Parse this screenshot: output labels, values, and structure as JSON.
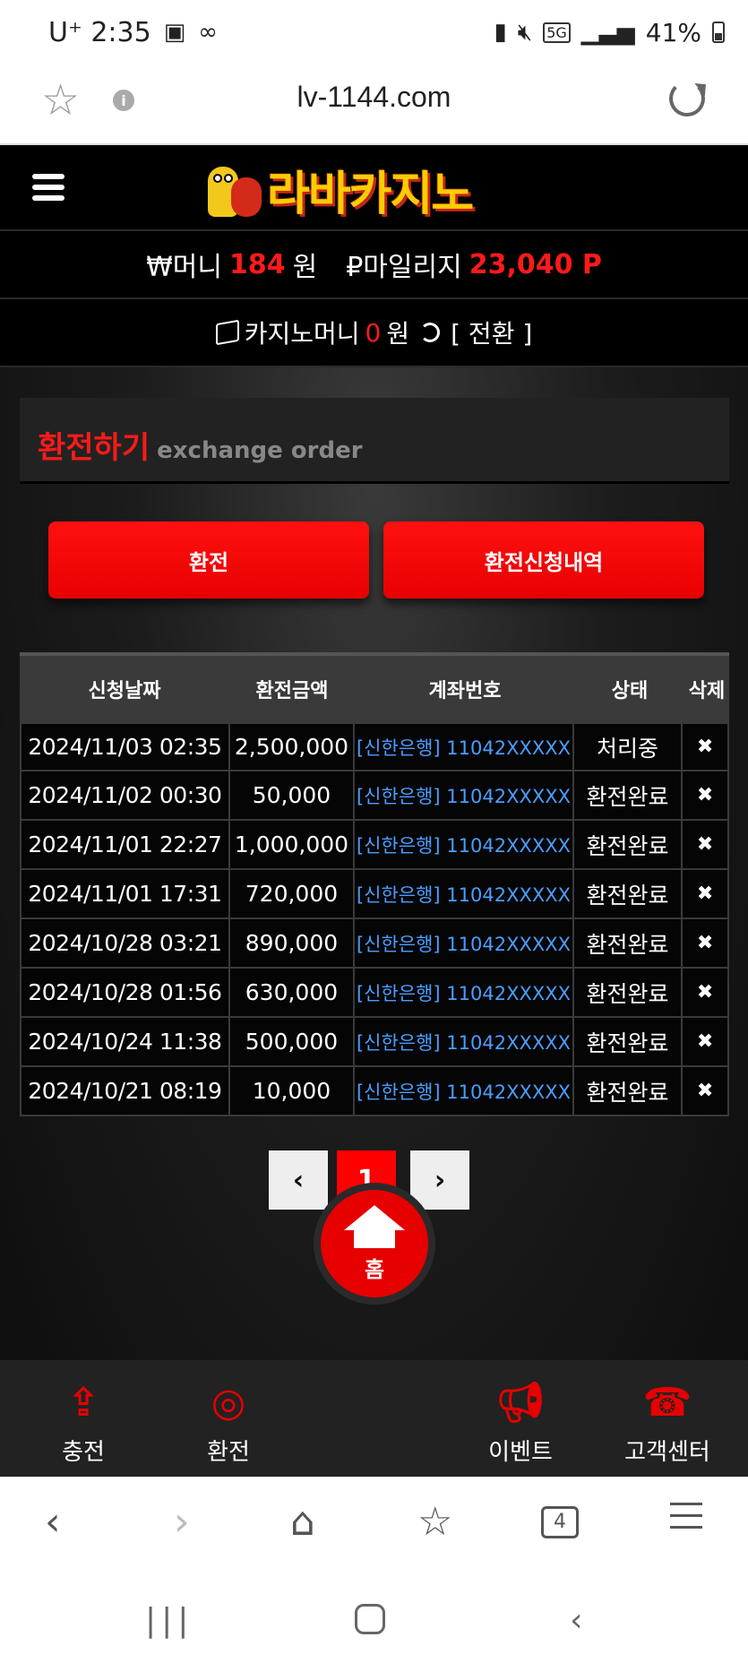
{
  "statusbar": {
    "carrier_time": "U⁺ 2:35",
    "battery": "41%",
    "network": "5G"
  },
  "browser": {
    "url": "lv-1144.com",
    "tab_count": "4"
  },
  "site": {
    "brand": "라바카지노",
    "wallet": {
      "money_label": "₩머니",
      "money_value": "184",
      "money_unit": "원",
      "mileage_label": "₽마일리지",
      "mileage_value": "23,040 P"
    },
    "casino": {
      "label": "카지노머니",
      "value": "0",
      "unit": "원",
      "convert_label": "[ 전환 ]"
    },
    "panel": {
      "title_ko": "환전하기",
      "title_en": "exchange order"
    },
    "buttons": {
      "exchange": "환전",
      "history": "환전신청내역"
    },
    "table": {
      "headers": [
        "신청날짜",
        "환전금액",
        "계좌번호",
        "상태",
        "삭제"
      ],
      "rows": [
        {
          "date": "2024/11/03 02:35",
          "amount": "2,500,000",
          "account": "[신한은행] 11042XXXXX",
          "status": "처리중",
          "del": "✖"
        },
        {
          "date": "2024/11/02 00:30",
          "amount": "50,000",
          "account": "[신한은행] 11042XXXXX",
          "status": "환전완료",
          "del": "✖"
        },
        {
          "date": "2024/11/01 22:27",
          "amount": "1,000,000",
          "account": "[신한은행] 11042XXXXX",
          "status": "환전완료",
          "del": "✖"
        },
        {
          "date": "2024/11/01 17:31",
          "amount": "720,000",
          "account": "[신한은행] 11042XXXXX",
          "status": "환전완료",
          "del": "✖"
        },
        {
          "date": "2024/10/28 03:21",
          "amount": "890,000",
          "account": "[신한은행] 11042XXXXX",
          "status": "환전완료",
          "del": "✖"
        },
        {
          "date": "2024/10/28 01:56",
          "amount": "630,000",
          "account": "[신한은행] 11042XXXXX",
          "status": "환전완료",
          "del": "✖"
        },
        {
          "date": "2024/10/24 11:38",
          "amount": "500,000",
          "account": "[신한은행] 11042XXXXX",
          "status": "환전완료",
          "del": "✖"
        },
        {
          "date": "2024/10/21 08:19",
          "amount": "10,000",
          "account": "[신한은행] 11042XXXXX",
          "status": "환전완료",
          "del": "✖"
        }
      ]
    },
    "pagination": {
      "prev": "‹",
      "current": "1",
      "next": "›"
    },
    "bottom_nav": {
      "charge": "충전",
      "exchange": "환전",
      "home": "홈",
      "event": "이벤트",
      "customer_center": "고객센터"
    }
  },
  "colors": {
    "accent": "#ff0000",
    "account_link": "#4a9eff",
    "background": "#111111"
  }
}
